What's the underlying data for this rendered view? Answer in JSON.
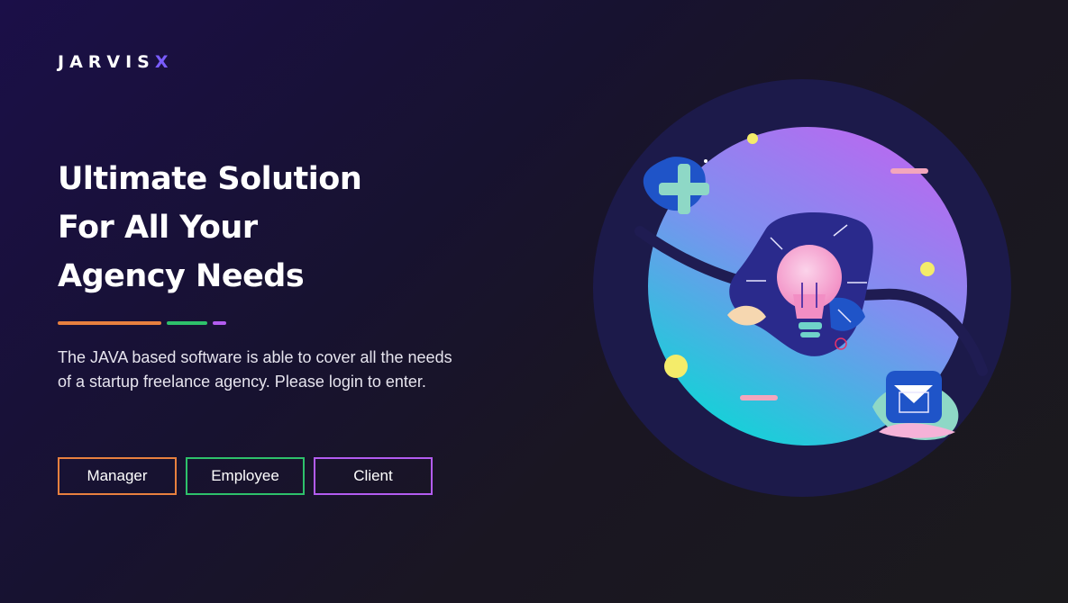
{
  "brand": {
    "name": "JARVIS",
    "suffix": "X"
  },
  "hero": {
    "lines": [
      "Ultimate Solution",
      "For All Your",
      "Agency Needs"
    ],
    "description": "The JAVA based software is able to cover all the needs of a startup freelance agency. Please login to enter."
  },
  "login_buttons": [
    {
      "label": "Manager",
      "color": "#e8803f"
    },
    {
      "label": "Employee",
      "color": "#2ec16b"
    },
    {
      "label": "Client",
      "color": "#b35cf0"
    }
  ],
  "accent_colors": {
    "orange": "#e8803f",
    "green": "#2ec16b",
    "purple": "#b35cf0",
    "brand_x": "#7a5cff"
  },
  "illustration": {
    "icons": [
      "plus-icon",
      "lightbulb-icon",
      "mail-icon"
    ]
  }
}
